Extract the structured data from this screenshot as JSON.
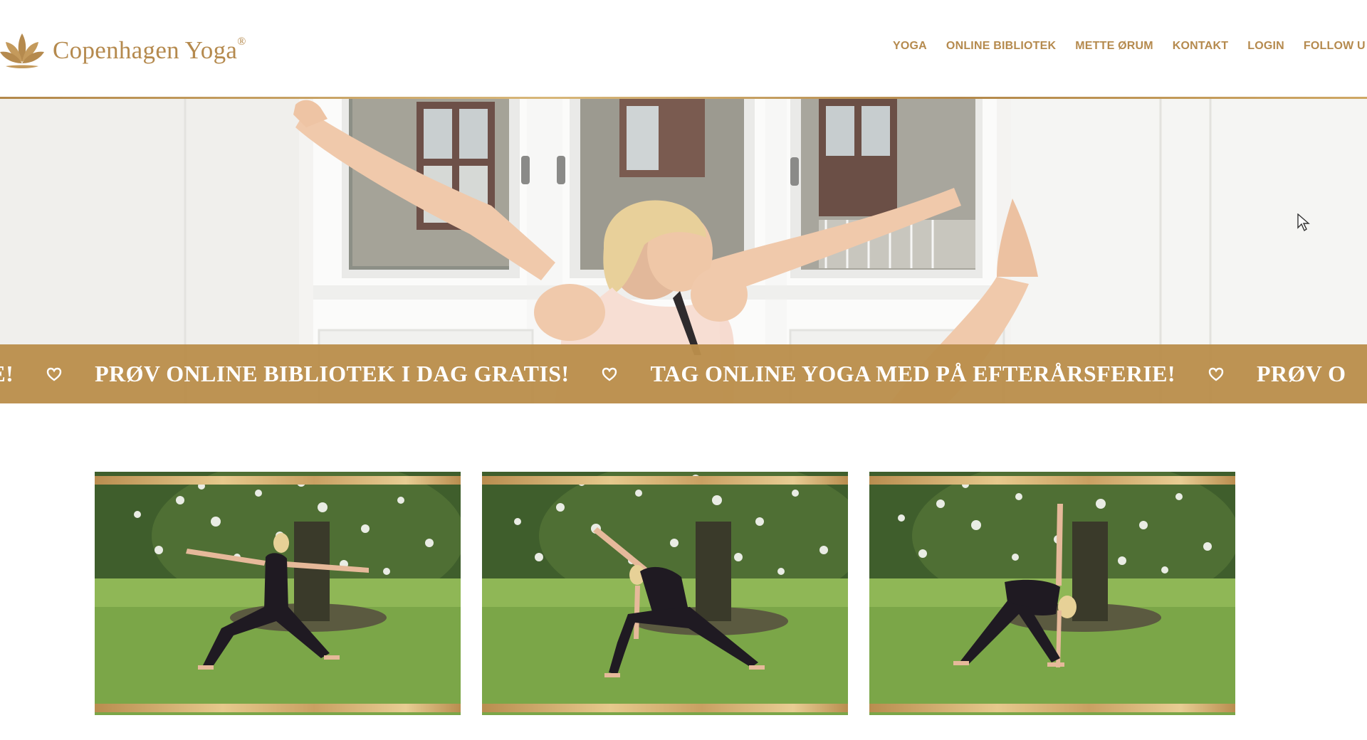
{
  "header": {
    "logo_text": "Copenhagen Yoga",
    "logo_mark": "®",
    "nav": [
      "YOGA",
      "ONLINE BIBLIOTEK",
      "METTE ØRUM",
      "KONTAKT",
      "LOGIN",
      "FOLLOW U"
    ]
  },
  "marquee": {
    "items": [
      "RIE!",
      "PRØV ONLINE BIBLIOTEK I DAG GRATIS!",
      "TAG ONLINE YOGA MED PÅ EFTERÅRSFERIE!",
      "PRØV O"
    ],
    "separator_icon": "heart-icon"
  },
  "hero": {
    "image": "woman-yoga-stretch-by-window"
  },
  "cards": [
    {
      "image": "warrior-pose-garden"
    },
    {
      "image": "extended-side-angle-garden"
    },
    {
      "image": "triangle-pose-garden"
    }
  ],
  "colors": {
    "gold": "#b58a4e",
    "banner": "#ba8f4c",
    "white": "#ffffff"
  }
}
